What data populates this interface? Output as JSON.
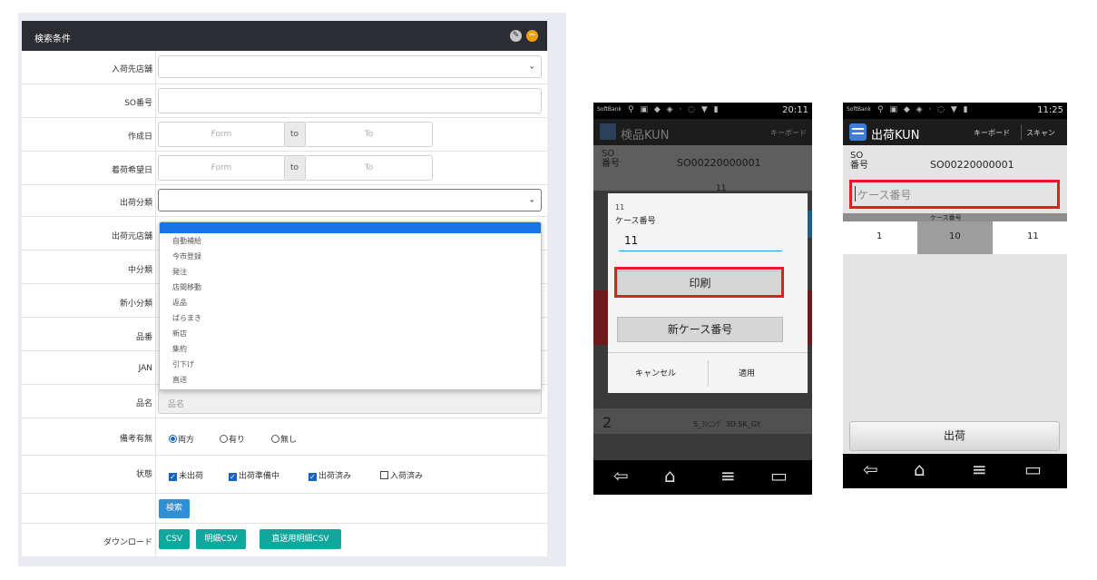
{
  "search_panel": {
    "title": "検索条件",
    "rows": {
      "arrival_store": "入荷先店舗",
      "so_number": "SO番号",
      "created_date": "作成日",
      "delivery_date": "着荷希望日",
      "shipment_type": "出荷分類",
      "source_store": "出荷元店舗",
      "mid_category": "中分類",
      "new_sub_category": "新小分類",
      "item_no": "品番",
      "jan": "JAN",
      "item_name": "品名",
      "remarks": "備考有無",
      "status": "状態",
      "download": "ダウンロード"
    },
    "date_range": {
      "from_placeholder": "Form",
      "to_label": "to",
      "to_placeholder": "To"
    },
    "item_name_placeholder": "品名",
    "dropdown_options": [
      "自動補給",
      "今市登録",
      "発注",
      "店間移動",
      "返品",
      "ばらまき",
      "新店",
      "集約",
      "引下げ",
      "直送"
    ],
    "remarks_options": [
      "両方",
      "有り",
      "無し"
    ],
    "status_options": [
      "未出荷",
      "出荷準備中",
      "出荷済み",
      "入荷済み"
    ],
    "search_button": "検索",
    "download_buttons": [
      "CSV",
      "明細CSV",
      "直送用明細CSV"
    ]
  },
  "phone1": {
    "carrier": "SoftBank",
    "time": "20:11",
    "app_title": "検品KUN",
    "keyboard": "キーボード",
    "so_label": "SO\n番号",
    "so_value": "SO00220000001",
    "behind_partial": "11",
    "behind_row_text": "S_ﾗﾝﾆﾝｸﾞ 3D SK_GY",
    "behind_row_num": "2",
    "dialog": {
      "number": "11",
      "label": "ケース番号",
      "value": "11",
      "print": "印刷",
      "new_case": "新ケース番号",
      "cancel": "キャンセル",
      "apply": "適用"
    }
  },
  "phone2": {
    "carrier": "SoftBank",
    "time": "11:25",
    "app_title": "出荷KUN",
    "keyboard": "キーボード",
    "scan": "スキャン",
    "so_label": "SO\n番号",
    "so_value": "SO00220000001",
    "case_placeholder": "ケース番号",
    "case_header": "ケース番号",
    "cases": [
      "1",
      "10",
      "11"
    ],
    "ship_button": "出荷"
  },
  "colors": {
    "highlight": "#e01e1e",
    "header": "#2b2d33",
    "primary": "#2d8fd5",
    "teal": "#12a79d"
  }
}
